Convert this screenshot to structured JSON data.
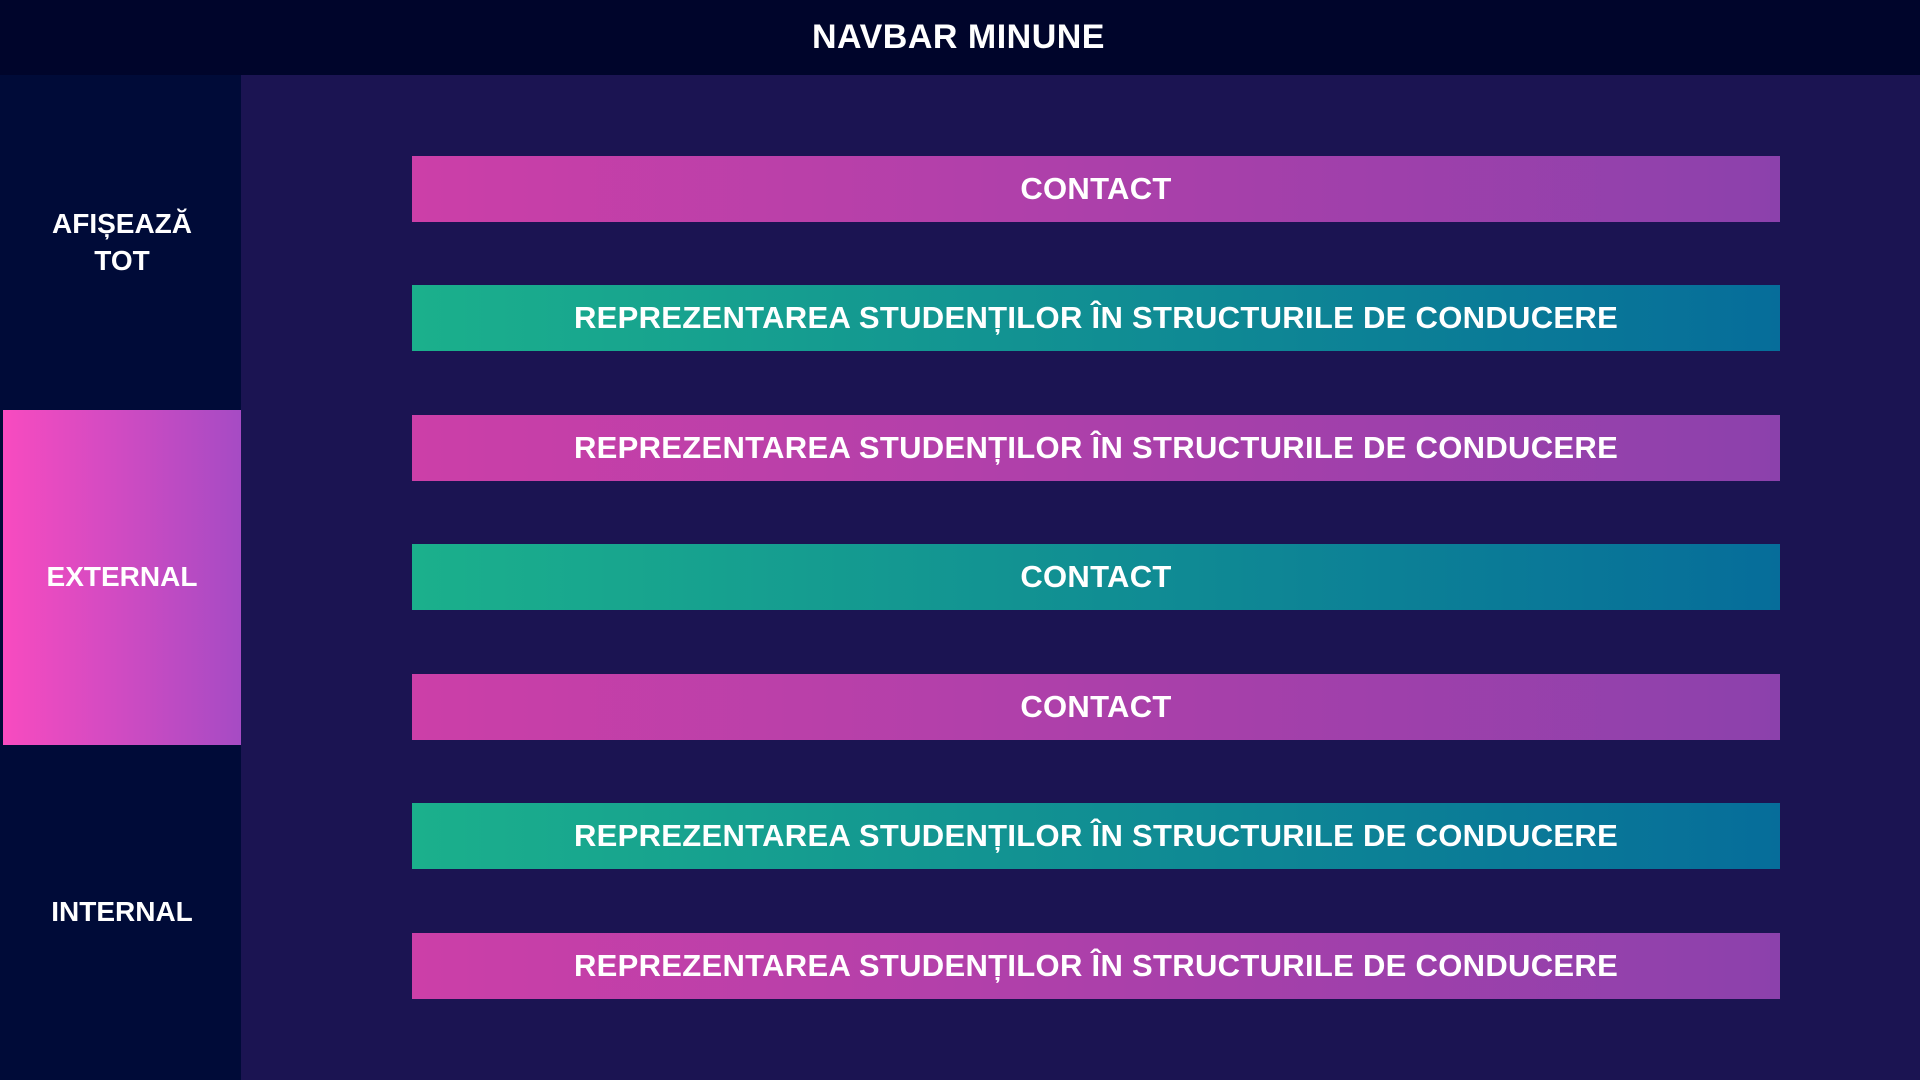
{
  "navbar": {
    "title": "NAVBAR MINUNE"
  },
  "sidebar": {
    "items": [
      {
        "label": "AFIȘEAZĂ\nTOT",
        "active": false
      },
      {
        "label": "EXTERNAL",
        "active": true
      },
      {
        "label": "INTERNAL",
        "active": false
      }
    ]
  },
  "content": {
    "bars": [
      {
        "label": "CONTACT",
        "style": "pink"
      },
      {
        "label": "REPREZENTAREA STUDENȚILOR ÎN STRUCTURILE DE CONDUCERE",
        "style": "teal"
      },
      {
        "label": "REPREZENTAREA STUDENȚILOR ÎN STRUCTURILE DE CONDUCERE",
        "style": "pink"
      },
      {
        "label": "CONTACT",
        "style": "teal"
      },
      {
        "label": "CONTACT",
        "style": "pink"
      },
      {
        "label": "REPREZENTAREA STUDENȚILOR ÎN STRUCTURILE DE CONDUCERE",
        "style": "teal"
      },
      {
        "label": "REPREZENTAREA STUDENȚILOR ÎN STRUCTURILE DE CONDUCERE",
        "style": "pink"
      }
    ]
  },
  "colors": {
    "navbar_bg": "#00052b",
    "sidebar_bg": "#000b38",
    "content_bg": "#1b1452",
    "pink_start": "#cc3fa8",
    "pink_end": "#8c41ac",
    "teal_start": "#1bb08c",
    "teal_end": "#066d9a",
    "active_start": "#f84bc0",
    "active_end": "#a64bc4"
  }
}
